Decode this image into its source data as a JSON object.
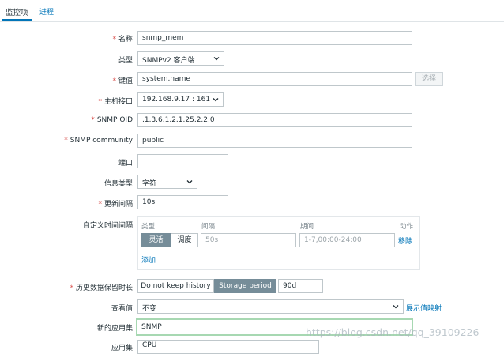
{
  "tabs": [
    {
      "label": "监控项",
      "active": true
    },
    {
      "label": "进程",
      "active": false
    }
  ],
  "form": {
    "name": {
      "label": "名称",
      "required": true,
      "value": "snmp_mem"
    },
    "type": {
      "label": "类型",
      "required": false,
      "value": "SNMPv2 客户端"
    },
    "key": {
      "label": "键值",
      "required": true,
      "value": "system.name",
      "button": "选择"
    },
    "host_interface": {
      "label": "主机接口",
      "required": true,
      "value": "192.168.9.17 : 161"
    },
    "snmp_oid": {
      "label": "SNMP OID",
      "required": true,
      "value": ".1.3.6.1.2.1.25.2.2.0"
    },
    "snmp_community": {
      "label": "SNMP community",
      "required": true,
      "value": "public"
    },
    "port": {
      "label": "端口",
      "required": false,
      "value": ""
    },
    "info_type": {
      "label": "信息类型",
      "required": false,
      "value": "字符"
    },
    "update_interval": {
      "label": "更新间隔",
      "required": true,
      "value": "10s"
    },
    "custom_intervals": {
      "label": "自定义时间间隔",
      "headers": [
        "类型",
        "间隔",
        "期间",
        "动作"
      ],
      "row": {
        "type_options": [
          "灵活",
          "调度"
        ],
        "type_selected": "灵活",
        "interval_placeholder": "50s",
        "period_placeholder": "1-7,00:00-24:00",
        "remove_label": "移除"
      },
      "add_label": "添加"
    },
    "history": {
      "label": "历史数据保留时长",
      "required": true,
      "options": [
        "Do not keep history",
        "Storage period"
      ],
      "selected": "Storage period",
      "value": "90d"
    },
    "show_value": {
      "label": "查看值",
      "value": "不变",
      "link": "展示值映射"
    },
    "new_application": {
      "label": "新的应用集",
      "value": "SNMP"
    },
    "application": {
      "label": "应用集",
      "value": "CPU"
    }
  },
  "watermark": "https://blog.csdn.net/qq_39109226"
}
